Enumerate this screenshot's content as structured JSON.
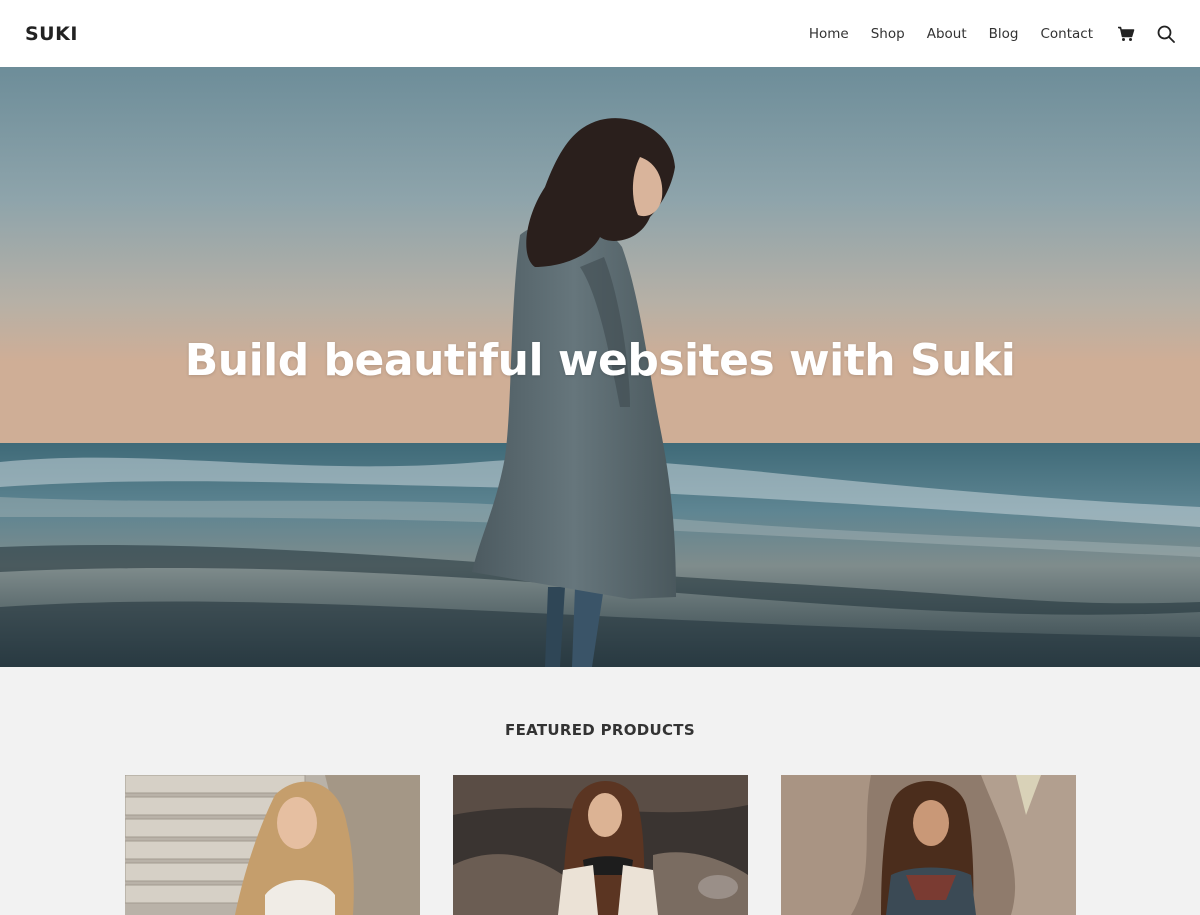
{
  "header": {
    "logo": "SUKI",
    "nav": [
      "Home",
      "Shop",
      "About",
      "Blog",
      "Contact"
    ],
    "icons": [
      "cart-icon",
      "search-icon"
    ]
  },
  "hero": {
    "title": "Build beautiful websites with Suki"
  },
  "featured": {
    "title": "FEATURED PRODUCTS",
    "products": [
      "product-image-1",
      "product-image-2",
      "product-image-3"
    ]
  },
  "colors": {
    "header_bg": "#ffffff",
    "text": "#222222",
    "section_bg": "#f2f2f2",
    "hero_text": "#ffffff"
  }
}
